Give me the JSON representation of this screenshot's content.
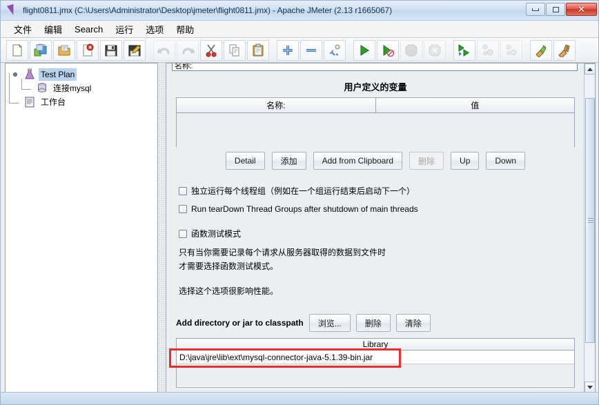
{
  "window": {
    "title": "flight0811.jmx (C:\\Users\\Administrator\\Desktop\\jmeter\\flight0811.jmx) - Apache JMeter (2.13 r1665067)",
    "icon": "jmeter-flask-icon",
    "controls": {
      "minimize": "minimize-icon",
      "maximize": "maximize-icon",
      "close": "✕"
    }
  },
  "menubar": {
    "items": [
      {
        "label": "文件",
        "name": "menu-file"
      },
      {
        "label": "编辑",
        "name": "menu-edit"
      },
      {
        "label": "Search",
        "name": "menu-search"
      },
      {
        "label": "运行",
        "name": "menu-run"
      },
      {
        "label": "选项",
        "name": "menu-options"
      },
      {
        "label": "帮助",
        "name": "menu-help"
      }
    ]
  },
  "toolbar": {
    "buttons": [
      {
        "name": "new-icon",
        "enabled": true
      },
      {
        "name": "templates-icon",
        "enabled": true
      },
      {
        "name": "open-icon",
        "enabled": true
      },
      {
        "name": "close-icon",
        "enabled": true
      },
      {
        "name": "save-icon",
        "enabled": true
      },
      {
        "name": "save-as-icon",
        "enabled": true
      },
      {
        "name": "undo-icon",
        "enabled": false
      },
      {
        "name": "redo-icon",
        "enabled": false
      },
      {
        "name": "cut-icon",
        "enabled": true
      },
      {
        "name": "copy-icon",
        "enabled": true
      },
      {
        "name": "paste-icon",
        "enabled": true
      },
      {
        "name": "expand-all-icon",
        "enabled": true
      },
      {
        "name": "collapse-all-icon",
        "enabled": true
      },
      {
        "name": "toggle-icon",
        "enabled": true
      },
      {
        "name": "start-icon",
        "enabled": true
      },
      {
        "name": "start-no-pauses-icon",
        "enabled": true
      },
      {
        "name": "stop-icon",
        "enabled": false
      },
      {
        "name": "shutdown-icon",
        "enabled": false
      },
      {
        "name": "start-remote-all-icon",
        "enabled": true
      },
      {
        "name": "stop-remote-all-icon",
        "enabled": false
      },
      {
        "name": "shutdown-remote-all-icon",
        "enabled": false
      },
      {
        "name": "clear-icon",
        "enabled": true
      },
      {
        "name": "clear-all-icon",
        "enabled": true
      }
    ]
  },
  "tree": {
    "nodes": [
      {
        "label": "Test Plan",
        "name": "tree-node-test-plan",
        "icon": "test-plan-icon",
        "selected": true
      },
      {
        "label": "连接mysql",
        "name": "tree-node-jdbc-config",
        "icon": "jdbc-config-icon",
        "selected": false
      },
      {
        "label": "工作台",
        "name": "tree-node-workbench",
        "icon": "workbench-icon",
        "selected": false
      }
    ]
  },
  "right_panel": {
    "name_field_value": "名称:",
    "udv": {
      "title": "用户定义的变量",
      "columns": [
        "名称:",
        "值"
      ],
      "rows": []
    },
    "udv_buttons": [
      {
        "label": "Detail",
        "name": "detail-button",
        "enabled": true
      },
      {
        "label": "添加",
        "name": "add-button",
        "enabled": true
      },
      {
        "label": "Add from Clipboard",
        "name": "add-from-clipboard-button",
        "enabled": true
      },
      {
        "label": "删除",
        "name": "delete-button",
        "enabled": false
      },
      {
        "label": "Up",
        "name": "up-button",
        "enabled": true
      },
      {
        "label": "Down",
        "name": "down-button",
        "enabled": true
      }
    ],
    "checkboxes": [
      {
        "label": "独立运行每个线程组（例如在一个组运行结束后启动下一个）",
        "name": "checkbox-serialize-thread-groups",
        "checked": false
      },
      {
        "label": "Run tearDown Thread Groups after shutdown of main threads",
        "name": "checkbox-run-teardown",
        "checked": false
      },
      {
        "label": "函数测试模式",
        "name": "checkbox-functional-test-mode",
        "checked": false
      }
    ],
    "description": {
      "line1": "只有当你需要记录每个请求从服务器取得的数据到文件时",
      "line2": "才需要选择函数测试模式。",
      "line3": "选择这个选项很影响性能。"
    },
    "classpath": {
      "label": "Add directory or jar to classpath",
      "buttons": [
        {
          "label": "浏览...",
          "name": "browse-button"
        },
        {
          "label": "删除",
          "name": "classpath-delete-button"
        },
        {
          "label": "清除",
          "name": "classpath-clear-button"
        }
      ],
      "table_header": "Library",
      "rows": [
        "D:\\java\\jre\\lib\\ext\\mysql-connector-java-5.1.39-bin.jar"
      ]
    }
  },
  "annotation": {
    "name": "red-highlight-rectangle",
    "color": "#ee2c2c"
  },
  "colors": {
    "titlebar_start": "#e4eef8",
    "titlebar_end": "#d8e6f6",
    "selection": "#b8d3ee",
    "accent_red": "#ee2c2c",
    "panel_bg": "#eceff2"
  }
}
